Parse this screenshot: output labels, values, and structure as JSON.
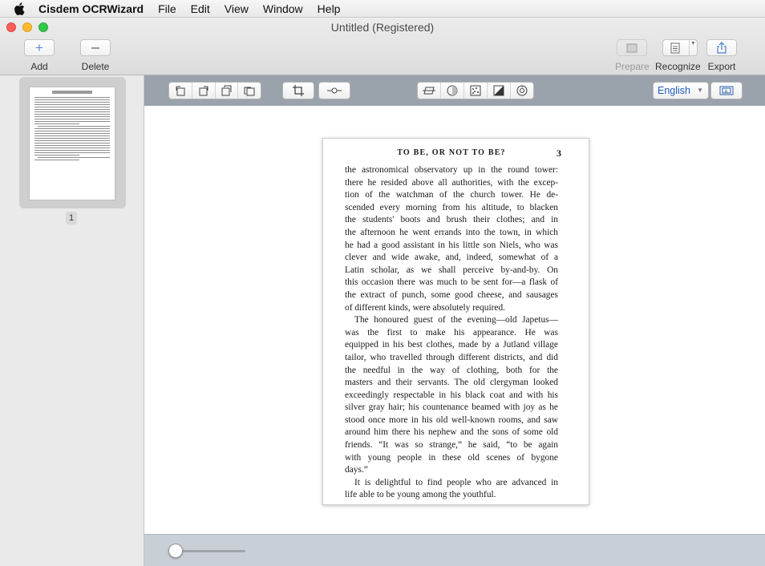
{
  "menubar": {
    "apple_icon": "apple-icon",
    "app_name": "Cisdem OCRWizard",
    "items": [
      "File",
      "Edit",
      "View",
      "Window",
      "Help"
    ]
  },
  "window": {
    "title": "Untitled (Registered)"
  },
  "toolbar": {
    "add_label": "Add",
    "delete_label": "Delete",
    "prepare_label": "Prepare",
    "recognize_label": "Recognize",
    "export_label": "Export"
  },
  "sidebar": {
    "pages": [
      {
        "number": "1"
      }
    ]
  },
  "edit_bar": {
    "language": "English",
    "icons": [
      "rotate-left-icon",
      "rotate-right-icon",
      "flip-horizontal-icon",
      "flip-vertical-icon",
      "crop-icon",
      "adjust-slider-icon",
      "deskew-icon",
      "brightness-icon",
      "denoise-icon",
      "contrast-icon",
      "auto-enhance-icon",
      "layout-icon"
    ]
  },
  "document": {
    "running_head": "TO BE, OR NOT TO BE?",
    "page_number": "3",
    "lines": [
      "the astronomical observatory up in the round tower:",
      "there he resided above all authorities, with the excep-",
      "tion of the watchman of the church tower. He de-",
      "scended every morning from his altitude, to blacken",
      "the students' boots and brush their clothes; and in",
      "the afternoon he went errands into the town, in which",
      "he had a good assistant in his little son Niels, who was",
      "clever and wide awake, and, indeed, somewhat of a",
      "Latin scholar, as we shall perceive by-and-by. On",
      "this occasion there was much to be sent for—a flask of",
      "the extract of punch, some good cheese, and sausages",
      "of different kinds, were absolutely required.",
      "The honoured guest of the evening—old Japetus—",
      "was the first to make his appearance. He was",
      "equipped in his best clothes, made by a Jutland village",
      "tailor, who travelled through different districts, and did",
      "the needful in the way of clothing, both for the",
      "masters and their servants. The old clergyman looked",
      "exceedingly respectable in his black coat and with his",
      "silver gray hair; his countenance beamed with joy as he",
      "stood once more in his old well-known rooms, and saw",
      "around him there his nephew and the sons of some old",
      "friends. “It was so strange,” he said, “to be again",
      "with young people in these old scenes of bygone",
      "days.”",
      "It is delightful to find people who are advanced in",
      "life able to be young among the youthful."
    ]
  },
  "zoom": {
    "level": 0
  }
}
